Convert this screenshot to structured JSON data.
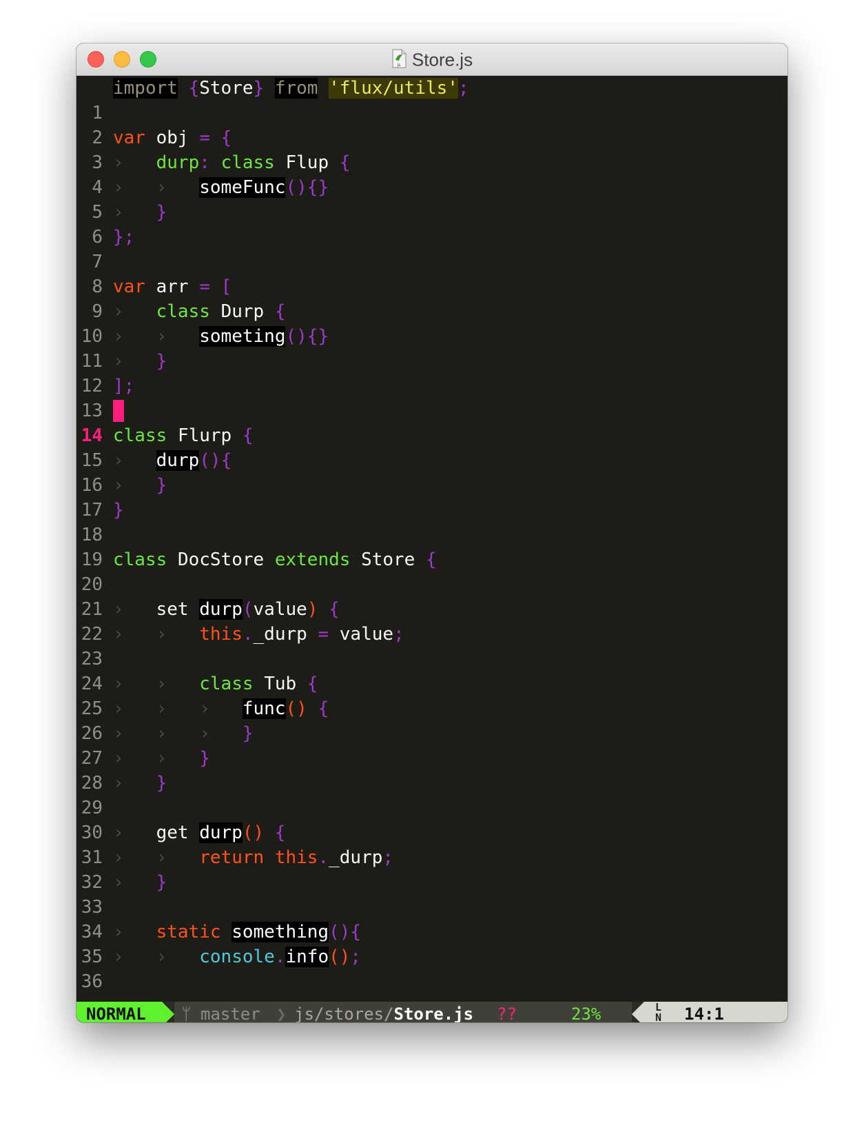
{
  "window": {
    "title": "Store.js",
    "file_icon": "js-document-icon"
  },
  "colors": {
    "background": "#1d1c17",
    "mode_green": "#5ff12d",
    "cursor_pink": "#fd1f7c",
    "keyword_orange": "#fd521a",
    "class_green": "#6ae841",
    "brace_purple": "#9b3acb"
  },
  "editor": {
    "current_line": 14,
    "lines": [
      {
        "n": "1"
      },
      {
        "n": "2"
      },
      {
        "n": "3"
      },
      {
        "n": "4"
      },
      {
        "n": "5"
      },
      {
        "n": "6"
      },
      {
        "n": "7"
      },
      {
        "n": "8"
      },
      {
        "n": "9"
      },
      {
        "n": "10"
      },
      {
        "n": "11"
      },
      {
        "n": "12"
      },
      {
        "n": "13"
      },
      {
        "n": "14"
      },
      {
        "n": "15"
      },
      {
        "n": "16"
      },
      {
        "n": "17"
      },
      {
        "n": "18"
      },
      {
        "n": "19"
      },
      {
        "n": "20"
      },
      {
        "n": "21"
      },
      {
        "n": "22"
      },
      {
        "n": "23"
      },
      {
        "n": "24"
      },
      {
        "n": "25"
      },
      {
        "n": "26"
      },
      {
        "n": "27"
      },
      {
        "n": "28"
      },
      {
        "n": "29"
      },
      {
        "n": "30"
      },
      {
        "n": "31"
      },
      {
        "n": "32"
      },
      {
        "n": "33"
      },
      {
        "n": "34"
      },
      {
        "n": "35"
      },
      {
        "n": "36"
      }
    ],
    "indent_guide": "›",
    "code": {
      "l1": {
        "kw": "import",
        "lb": "{",
        "name": "Store",
        "rb": "}",
        "from": "from",
        "str": "'flux/utils'",
        "semi": ";"
      },
      "l3": {
        "kw": "var",
        "name": "obj",
        "eq": "=",
        "lb": "{"
      },
      "l4": {
        "key": "durp",
        "colon": ":",
        "cls": "class",
        "name": "Flup",
        "lb": "{"
      },
      "l5": {
        "fn": "someFunc",
        "paren": "()",
        "braces": "{}"
      },
      "l6": {
        "rb": "}"
      },
      "l7": {
        "end": "};"
      },
      "l9": {
        "kw": "var",
        "name": "arr",
        "eq": "=",
        "lb": "["
      },
      "l10": {
        "cls": "class",
        "name": "Durp",
        "lb": "{"
      },
      "l11": {
        "fn": "someting",
        "paren": "()",
        "braces": "{}"
      },
      "l12": {
        "rb": "}"
      },
      "l13": {
        "end": "];"
      },
      "l15": {
        "cls": "class",
        "name": "Flurp",
        "lb": "{"
      },
      "l16": {
        "fn": "durp",
        "paren": "()",
        "lb": "{"
      },
      "l17": {
        "rb": "}"
      },
      "l18": {
        "rb": "}"
      },
      "l20": {
        "cls": "class",
        "name": "DocStore",
        "ext": "extends",
        "parent": "Store",
        "lb": "{"
      },
      "l22": {
        "set": "set",
        "fn": "durp",
        "lp": "(",
        "arg": "value",
        "rp": ")",
        "lb": "{"
      },
      "l23": {
        "this": "this",
        "dot": ".",
        "prop": "_durp",
        "eq": "=",
        "val": "value",
        "semi": ";"
      },
      "l25": {
        "cls": "class",
        "name": "Tub",
        "lb": "{"
      },
      "l26": {
        "fn": "func",
        "paren": "()",
        "lb": "{"
      },
      "l27": {
        "rb": "}"
      },
      "l28": {
        "rb": "}"
      },
      "l29": {
        "rb": "}"
      },
      "l31": {
        "get": "get",
        "fn": "durp",
        "paren": "()",
        "lb": "{"
      },
      "l32": {
        "ret": "return",
        "this": "this",
        "dot": ".",
        "prop": "_durp",
        "semi": ";"
      },
      "l33": {
        "rb": "}"
      },
      "l35": {
        "static": "static",
        "fn": "something",
        "paren": "()",
        "lb": "{"
      },
      "l36": {
        "obj": "console",
        "dot": ".",
        "fn": "info",
        "paren": "()",
        "semi": ";"
      }
    }
  },
  "statusline": {
    "mode": "NORMAL",
    "branch_icon": "git-branch-icon",
    "branch": "master",
    "path_dir": "js/stores/",
    "path_file": "Store.js",
    "modified_flag": "??",
    "percent": "23%",
    "line_icon_top": "L",
    "line_icon_bottom": "N",
    "position": "14:1"
  }
}
